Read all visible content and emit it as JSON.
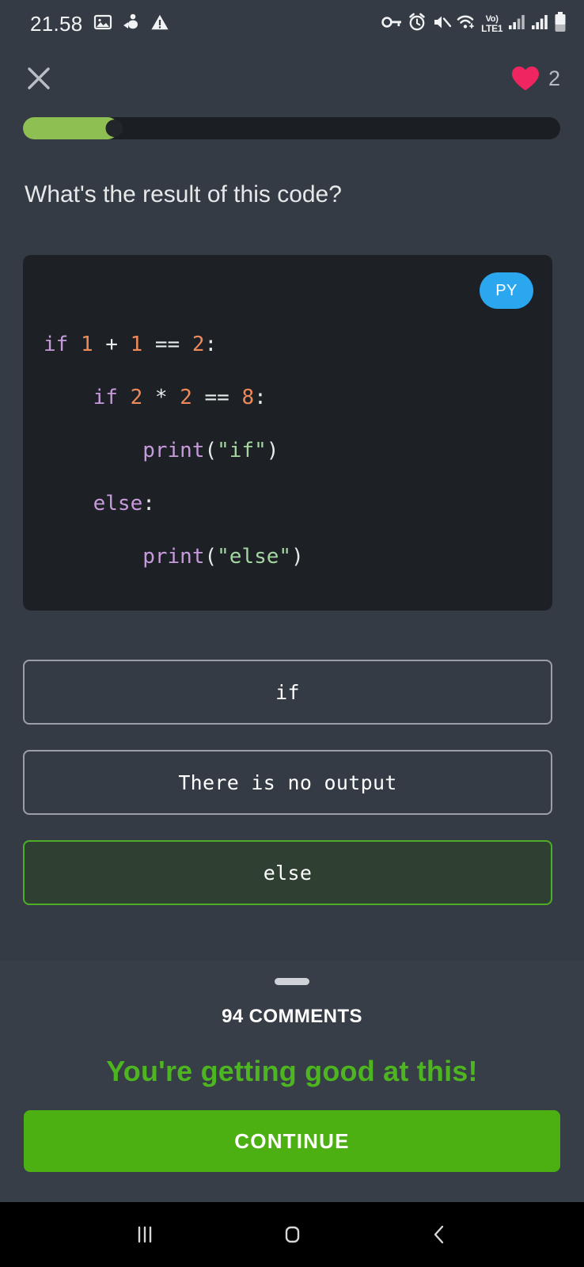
{
  "status_bar": {
    "time": "21.58",
    "left_icons": [
      "image-icon",
      "download-figure-icon",
      "warning-triangle-icon"
    ],
    "right_icons": [
      "vpn-key-icon",
      "alarm-icon",
      "mute-icon",
      "wifi-icon",
      "signal-bars-1-icon",
      "signal-bars-2-icon",
      "battery-icon"
    ],
    "volte_top": "Vo)",
    "volte_bottom": "LTE1"
  },
  "top_bar": {
    "close_icon": "close-icon",
    "heart_icon": "heart-icon",
    "heart_count": "2",
    "heart_color": "#ee2560"
  },
  "progress": {
    "percent": 17.8,
    "fill_color": "#8dbf52",
    "track_color": "#1b1e22"
  },
  "question": {
    "text": "What's the result of this code?"
  },
  "code_card": {
    "language_badge": "PY",
    "badge_color": "#2aa7ef",
    "lines": [
      [
        {
          "t": "if ",
          "c": "kw"
        },
        {
          "t": "1",
          "c": "num"
        },
        {
          "t": " + ",
          "c": "op"
        },
        {
          "t": "1",
          "c": "num"
        },
        {
          "t": " == ",
          "c": "op"
        },
        {
          "t": "2",
          "c": "num"
        },
        {
          "t": ":",
          "c": "op"
        }
      ],
      [
        {
          "t": "    if ",
          "c": "kw"
        },
        {
          "t": "2",
          "c": "num"
        },
        {
          "t": " * ",
          "c": "op"
        },
        {
          "t": "2",
          "c": "num"
        },
        {
          "t": " == ",
          "c": "op"
        },
        {
          "t": "8",
          "c": "num"
        },
        {
          "t": ":",
          "c": "op"
        }
      ],
      [
        {
          "t": "        print",
          "c": "fn"
        },
        {
          "t": "(",
          "c": "pl"
        },
        {
          "t": "\"if\"",
          "c": "str"
        },
        {
          "t": ")",
          "c": "pl"
        }
      ],
      [
        {
          "t": "    else",
          "c": "kw"
        },
        {
          "t": ":",
          "c": "op"
        }
      ],
      [
        {
          "t": "        print",
          "c": "fn"
        },
        {
          "t": "(",
          "c": "pl"
        },
        {
          "t": "\"else\"",
          "c": "str"
        },
        {
          "t": ")",
          "c": "pl"
        }
      ]
    ]
  },
  "options": [
    {
      "label": "if",
      "selected": false
    },
    {
      "label": "There is no output",
      "selected": false
    },
    {
      "label": "else",
      "selected": true
    }
  ],
  "sheet": {
    "grabber": "drag-handle",
    "comments_label": "94 COMMENTS",
    "praise_text": "You're getting good at this!",
    "praise_color": "#4cb520",
    "continue_label": "CONTINUE",
    "continue_color": "#4caf12"
  },
  "nav_bar": {
    "recents_icon": "recents-icon",
    "home_icon": "home-icon",
    "back_icon": "back-icon"
  }
}
